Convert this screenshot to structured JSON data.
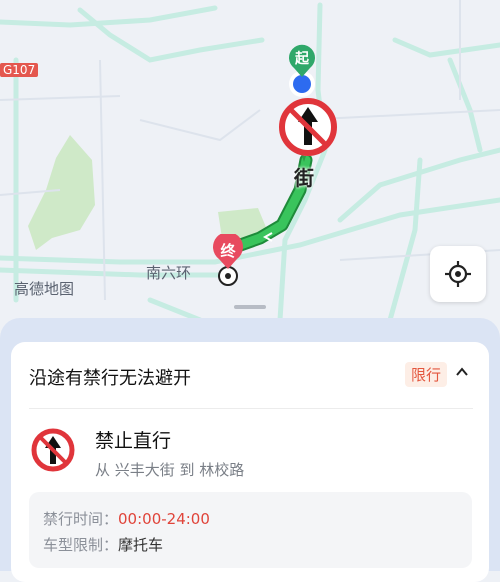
{
  "map": {
    "road_badge": "G107",
    "watermark": "高德地图",
    "road_label_south": "南六环",
    "street_label": "街",
    "start_marker": "起",
    "end_marker": "终"
  },
  "sheet": {
    "title": "沿途有禁行无法避开",
    "tag": "限行",
    "collapse_icon": "chevron-up-icon",
    "rule": {
      "icon": "no-straight-sign-icon",
      "title": "禁止直行",
      "subtitle": "从 兴丰大街 到 林校路"
    },
    "details": {
      "time_label": "禁行时间：",
      "time_value": "00:00-24:00",
      "vehicle_label": "车型限制：",
      "vehicle_value": "摩托车"
    }
  }
}
